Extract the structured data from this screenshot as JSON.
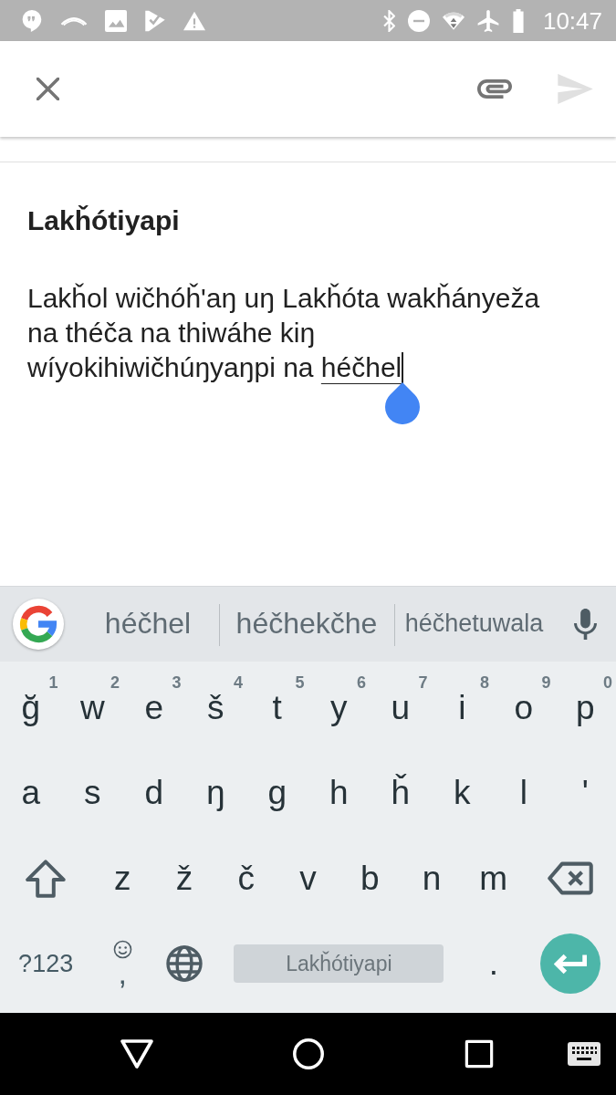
{
  "status_bar": {
    "time": "10:47"
  },
  "app_bar": {
    "actions": [
      {
        "kind": "attach",
        "disabled": false
      },
      {
        "kind": "send",
        "disabled": true
      }
    ]
  },
  "note": {
    "title": "Lakȟótiyapi",
    "body": "Lakȟol wičhóȟ'aŋ uŋ Lakȟóta wakȟányeža na théča na thiwáhe kiŋ wíyokihiwičhúŋyaŋpi na",
    "composing_word": "héčhel"
  },
  "keyboard": {
    "suggestions": [
      "héčhel",
      "héčhekčhe",
      "héčhetuwala"
    ],
    "rows": [
      [
        {
          "kind": "letter",
          "label": "ğ",
          "hint": "1"
        },
        {
          "kind": "letter",
          "label": "w",
          "hint": "2"
        },
        {
          "kind": "letter",
          "label": "e",
          "hint": "3"
        },
        {
          "kind": "letter",
          "label": "š",
          "hint": "4"
        },
        {
          "kind": "letter",
          "label": "t",
          "hint": "5"
        },
        {
          "kind": "letter",
          "label": "y",
          "hint": "6"
        },
        {
          "kind": "letter",
          "label": "u",
          "hint": "7"
        },
        {
          "kind": "letter",
          "label": "i",
          "hint": "8"
        },
        {
          "kind": "letter",
          "label": "o",
          "hint": "9"
        },
        {
          "kind": "letter",
          "label": "p",
          "hint": "0"
        }
      ],
      [
        {
          "kind": "letter",
          "label": "a"
        },
        {
          "kind": "letter",
          "label": "s"
        },
        {
          "kind": "letter",
          "label": "d"
        },
        {
          "kind": "letter",
          "label": "ŋ"
        },
        {
          "kind": "letter",
          "label": "g"
        },
        {
          "kind": "letter",
          "label": "h"
        },
        {
          "kind": "letter",
          "label": "ȟ"
        },
        {
          "kind": "letter",
          "label": "k"
        },
        {
          "kind": "letter",
          "label": "l"
        },
        {
          "kind": "letter",
          "label": "'"
        }
      ],
      [
        {
          "kind": "shift"
        },
        {
          "kind": "letter",
          "label": "z"
        },
        {
          "kind": "letter",
          "label": "ž"
        },
        {
          "kind": "letter",
          "label": "č"
        },
        {
          "kind": "letter",
          "label": "v"
        },
        {
          "kind": "letter",
          "label": "b"
        },
        {
          "kind": "letter",
          "label": "n"
        },
        {
          "kind": "letter",
          "label": "m"
        },
        {
          "kind": "backspace"
        }
      ]
    ],
    "bottom_row": [
      {
        "kind": "symbols",
        "label": "?123"
      },
      {
        "kind": "comma",
        "label": ","
      },
      {
        "kind": "language"
      },
      {
        "kind": "space",
        "label": "Lakȟótiyapi"
      },
      {
        "kind": "letter",
        "label": "."
      },
      {
        "kind": "enter"
      }
    ]
  }
}
